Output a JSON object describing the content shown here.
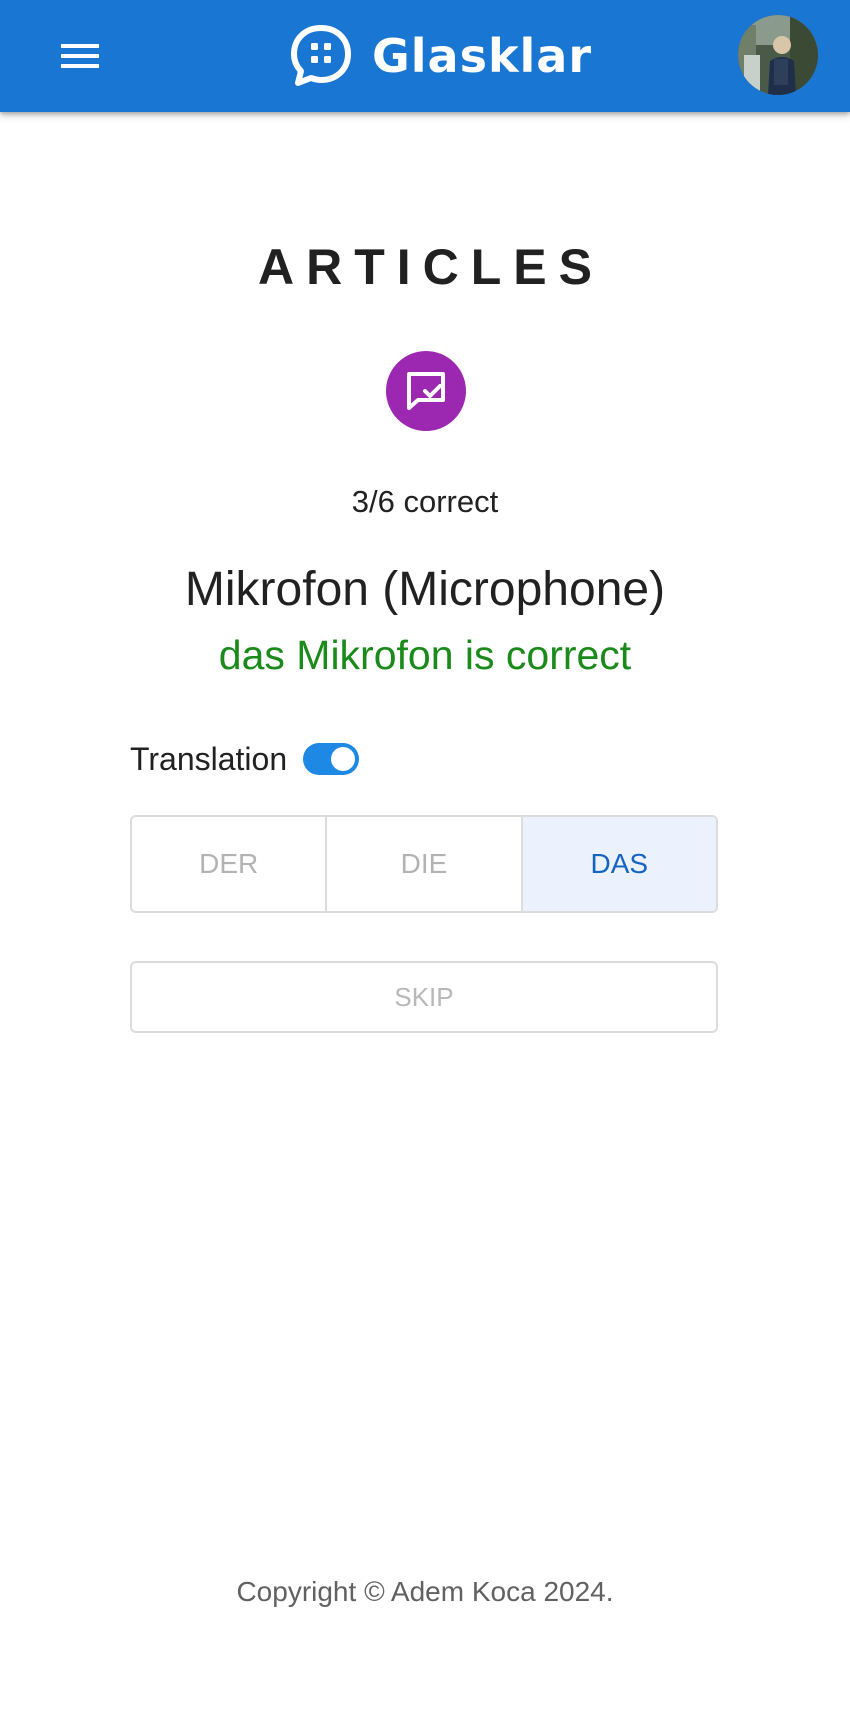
{
  "appbar": {
    "brand_name": "Glasklar",
    "menu_icon": "hamburger-menu-icon",
    "logo_icon": "chat-bubble-logo-icon",
    "color": "#1976d2"
  },
  "page": {
    "title": "ARTICLES",
    "badge_icon": "quiz-check-icon",
    "badge_color": "#9c27b0",
    "score": "3/6 correct",
    "word": "Mikrofon (Microphone)",
    "feedback": "das Mikrofon is correct",
    "feedback_color": "#1a8a1a"
  },
  "translation": {
    "label": "Translation",
    "enabled": true
  },
  "articles": {
    "options": [
      "DER",
      "DIE",
      "DAS"
    ],
    "selected": "DAS"
  },
  "skip_label": "SKIP",
  "footer": {
    "copyright": "Copyright © Adem Koca 2024."
  }
}
